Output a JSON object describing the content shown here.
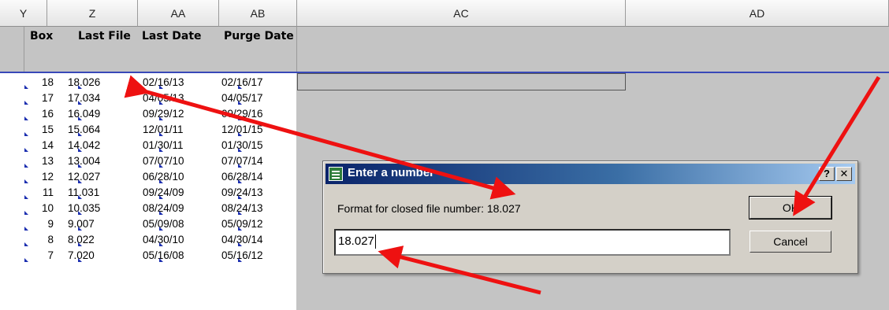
{
  "columns": [
    "Y",
    "Z",
    "AA",
    "AB",
    "AC",
    "AD"
  ],
  "labels": {
    "box": "Box",
    "last_file": "Last File",
    "last_date": "Last Date",
    "purge_date": "Purge Date"
  },
  "rows": [
    {
      "box": "18",
      "file": "18.026",
      "date": "02/16/13",
      "purge": "02/16/17"
    },
    {
      "box": "17",
      "file": "17.034",
      "date": "04/05/13",
      "purge": "04/05/17"
    },
    {
      "box": "16",
      "file": "16.049",
      "date": "09/29/12",
      "purge": "09/29/16"
    },
    {
      "box": "15",
      "file": "15.064",
      "date": "12/01/11",
      "purge": "12/01/15"
    },
    {
      "box": "14",
      "file": "14.042",
      "date": "01/30/11",
      "purge": "01/30/15"
    },
    {
      "box": "13",
      "file": "13.004",
      "date": "07/07/10",
      "purge": "07/07/14"
    },
    {
      "box": "12",
      "file": "12.027",
      "date": "06/28/10",
      "purge": "06/28/14"
    },
    {
      "box": "11",
      "file": "11.031",
      "date": "09/24/09",
      "purge": "09/24/13"
    },
    {
      "box": "10",
      "file": "10.035",
      "date": "08/24/09",
      "purge": "08/24/13"
    },
    {
      "box": "9",
      "file": "9.007",
      "date": "05/09/08",
      "purge": "05/09/12"
    },
    {
      "box": "8",
      "file": "8.022",
      "date": "04/30/10",
      "purge": "04/30/14"
    },
    {
      "box": "7",
      "file": "7.020",
      "date": "05/16/08",
      "purge": "05/16/12"
    }
  ],
  "dialog": {
    "title": "Enter a number",
    "help_btn": "?",
    "close_btn": "✕",
    "prompt": "Format for closed file number: 18.027",
    "input_value": "18.027",
    "ok_label": "OK",
    "cancel_label": "Cancel"
  },
  "colors": {
    "arrow": "#ee1111",
    "titlebar": "#0a246a",
    "separator": "#3848b8"
  }
}
